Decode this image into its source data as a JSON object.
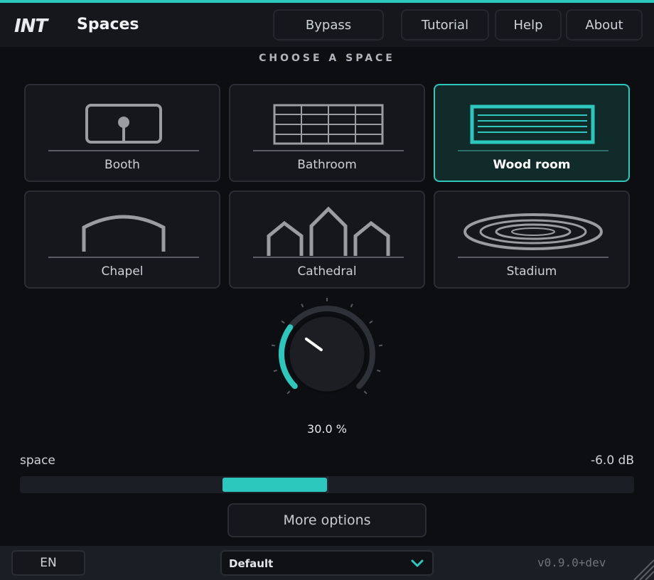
{
  "header": {
    "logo_text": "INT",
    "app_title": "Spaces",
    "buttons": [
      {
        "label": "Bypass"
      },
      {
        "label": "Tutorial"
      },
      {
        "label": "Help"
      },
      {
        "label": "About"
      }
    ]
  },
  "spaces": {
    "title": "CHOOSE A SPACE",
    "selected": "Wood room",
    "items": [
      {
        "label": "Booth",
        "icon": "booth-icon"
      },
      {
        "label": "Bathroom",
        "icon": "bathroom-icon"
      },
      {
        "label": "Wood room",
        "icon": "wood-room-icon"
      },
      {
        "label": "Chapel",
        "icon": "chapel-icon"
      },
      {
        "label": "Cathedral",
        "icon": "cathedral-icon"
      },
      {
        "label": "Stadium",
        "icon": "stadium-icon"
      }
    ]
  },
  "mix_knob": {
    "value_text": "30.0 %",
    "value_fraction": 0.3
  },
  "space_param": {
    "label": "space",
    "value_text": "-6.0 dB",
    "value_fraction": -0.34
  },
  "more_options_label": "More options",
  "footer": {
    "language": "EN",
    "preset": "Default",
    "version": "v0.9.0+dev"
  },
  "colors": {
    "accent": "#2cc7bd",
    "background": "#0d0e12",
    "panel": "#15171c",
    "border": "#2a2d34"
  }
}
